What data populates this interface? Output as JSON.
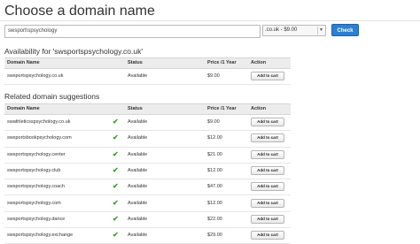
{
  "page": {
    "title": "Choose a domain name"
  },
  "search": {
    "value": "swsport\\spsychology",
    "tld_selected": ".co.uk - $9.00",
    "check_label": "Check"
  },
  "availability": {
    "heading": "Availability for 'swsportspsychology.co.uk'",
    "columns": {
      "name": "Domain Name",
      "status": "Status",
      "price": "Price /1 Year",
      "action": "Action"
    },
    "rows": [
      {
        "name": "swsportspsychology.co.uk",
        "status": "Available",
        "price": "$9.00",
        "action": "Add to cart"
      }
    ]
  },
  "related": {
    "heading": "Related domain suggestions",
    "columns": {
      "name": "Domain Name",
      "status": "Status",
      "price": "Price /1 Year",
      "action": "Action"
    },
    "rows": [
      {
        "name": "swathleticsspsychology.co.uk",
        "status": "Available",
        "price": "$9.00",
        "action": "Add to cart",
        "check": "✔"
      },
      {
        "name": "swsportsbookpsychology.com",
        "status": "Available",
        "price": "$12.00",
        "action": "Add to cart",
        "check": "✔"
      },
      {
        "name": "swsportspsychology.center",
        "status": "Available",
        "price": "$21.00",
        "action": "Add to cart",
        "check": "✔"
      },
      {
        "name": "swsportspsychology.club",
        "status": "Available",
        "price": "$12.00",
        "action": "Add to cart",
        "check": "✔"
      },
      {
        "name": "swsportspsychology.coach",
        "status": "Available",
        "price": "$47.00",
        "action": "Add to cart",
        "check": "✔"
      },
      {
        "name": "swsportspsychology.com",
        "status": "Available",
        "price": "$12.00",
        "action": "Add to cart",
        "check": "✔"
      },
      {
        "name": "swsportspsychology.dance",
        "status": "Available",
        "price": "$22.00",
        "action": "Add to cart",
        "check": "✔"
      },
      {
        "name": "swsportspsychology.exchange",
        "status": "Available",
        "price": "$29.00",
        "action": "Add to cart",
        "check": "✔"
      }
    ]
  },
  "colors": {
    "accent": "#2f7fd0",
    "check": "#3a9a2e",
    "header_bg": "#ececec"
  },
  "icons": {
    "available": "check-icon",
    "select_arrow": "chevron-down-icon"
  }
}
